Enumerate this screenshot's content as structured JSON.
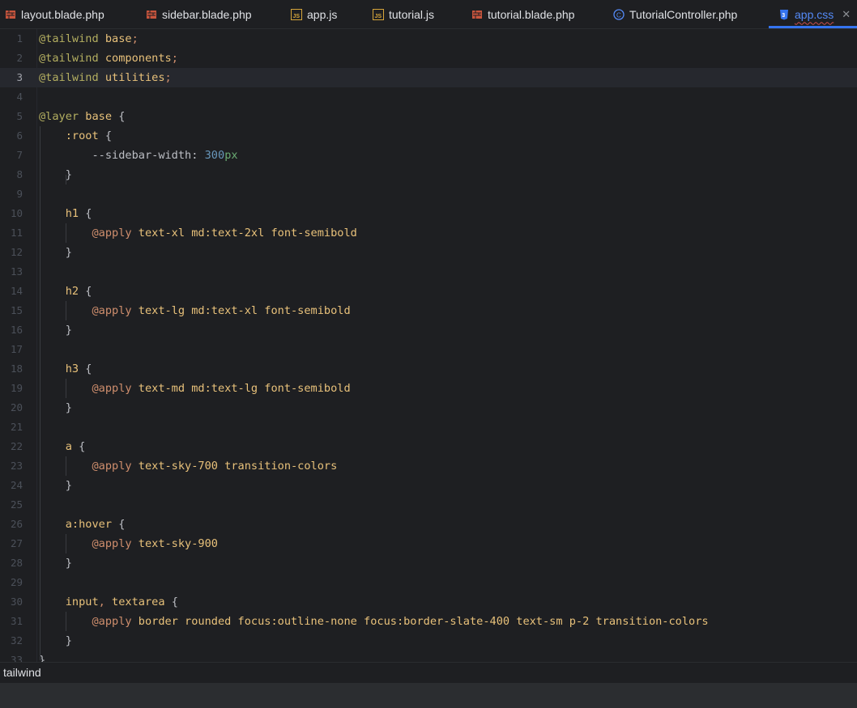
{
  "tabs": [
    {
      "label": "layout.blade.php",
      "icon": "blade-icon"
    },
    {
      "label": "sidebar.blade.php",
      "icon": "blade-icon"
    },
    {
      "label": "app.js",
      "icon": "js-icon"
    },
    {
      "label": "tutorial.js",
      "icon": "js-icon"
    },
    {
      "label": "tutorial.blade.php",
      "icon": "blade-icon"
    },
    {
      "label": "TutorialController.php",
      "icon": "php-class-icon"
    },
    {
      "label": "app.css",
      "icon": "css-icon",
      "active": true,
      "close": "✕"
    }
  ],
  "editor": {
    "current_line": 3,
    "lines": [
      [
        [
          "@tailwind",
          "at"
        ],
        [
          " base",
          "sel"
        ],
        [
          ";",
          "kw"
        ]
      ],
      [
        [
          "@tailwind",
          "at"
        ],
        [
          " components",
          "sel"
        ],
        [
          ";",
          "kw"
        ]
      ],
      [
        [
          "@tailwind",
          "at"
        ],
        [
          " utilities",
          "sel"
        ],
        [
          ";",
          "kw"
        ]
      ],
      [],
      [
        [
          "@layer",
          "at"
        ],
        [
          " base ",
          "sel"
        ],
        [
          "{",
          "prop"
        ]
      ],
      [
        [
          "    :root ",
          "sel"
        ],
        [
          "{",
          "prop"
        ]
      ],
      [
        [
          "        --sidebar-width",
          "prop"
        ],
        [
          ": ",
          "prop"
        ],
        [
          "300",
          "num"
        ],
        [
          "px",
          "unit"
        ]
      ],
      [
        [
          "    }",
          "prop"
        ]
      ],
      [],
      [
        [
          "    h1 ",
          "sel"
        ],
        [
          "{",
          "prop"
        ]
      ],
      [
        [
          "        @apply",
          "kw"
        ],
        [
          " text-xl md:text-2xl font-semibold",
          "txt"
        ]
      ],
      [
        [
          "    }",
          "prop"
        ]
      ],
      [],
      [
        [
          "    h2 ",
          "sel"
        ],
        [
          "{",
          "prop"
        ]
      ],
      [
        [
          "        @apply",
          "kw"
        ],
        [
          " text-lg md:text-xl font-semibold",
          "txt"
        ]
      ],
      [
        [
          "    }",
          "prop"
        ]
      ],
      [],
      [
        [
          "    h3 ",
          "sel"
        ],
        [
          "{",
          "prop"
        ]
      ],
      [
        [
          "        @apply",
          "kw"
        ],
        [
          " text-md md:text-lg font-semibold",
          "txt"
        ]
      ],
      [
        [
          "    }",
          "prop"
        ]
      ],
      [],
      [
        [
          "    a ",
          "sel"
        ],
        [
          "{",
          "prop"
        ]
      ],
      [
        [
          "        @apply",
          "kw"
        ],
        [
          " text-sky-700 transition-colors",
          "txt"
        ]
      ],
      [
        [
          "    }",
          "prop"
        ]
      ],
      [],
      [
        [
          "    a:hover ",
          "sel"
        ],
        [
          "{",
          "prop"
        ]
      ],
      [
        [
          "        @apply",
          "kw"
        ],
        [
          " text-sky-900",
          "txt"
        ]
      ],
      [
        [
          "    }",
          "prop"
        ]
      ],
      [],
      [
        [
          "    input",
          "sel"
        ],
        [
          ", ",
          "kw"
        ],
        [
          "textarea ",
          "sel"
        ],
        [
          "{",
          "prop"
        ]
      ],
      [
        [
          "        @apply",
          "kw"
        ],
        [
          " border rounded focus:outline-none focus:border-slate-400 text-sm p-2 transition-colors",
          "txt"
        ]
      ],
      [
        [
          "    }",
          "prop"
        ]
      ],
      [
        [
          "}",
          "prop"
        ]
      ]
    ]
  },
  "breadcrumb": {
    "label": "tailwind"
  },
  "colors": {
    "accent": "#3574f0",
    "background": "#1e1f22"
  }
}
